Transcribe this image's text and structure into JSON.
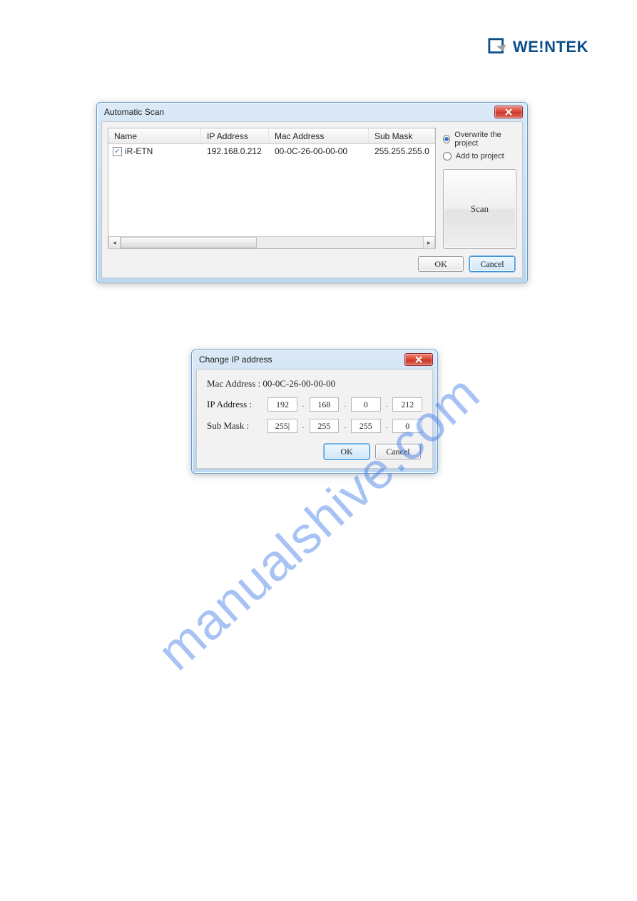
{
  "logo": {
    "brand": "WEINTEK"
  },
  "watermark": "manualshive.com",
  "dlg_scan": {
    "title": "Automatic Scan",
    "cols": {
      "name": "Name",
      "ip": "IP Address",
      "mac": "Mac Address",
      "mask": "Sub Mask"
    },
    "row": {
      "checked": "☑",
      "name": "iR-ETN",
      "ip": "192.168.0.212",
      "mac": "00-0C-26-00-00-00",
      "mask": "255.255.255.0"
    },
    "radio_overwrite": "Overwrite the project",
    "radio_add": "Add to project",
    "scan_btn": "Scan",
    "ok": "OK",
    "cancel": "Cancel"
  },
  "dlg_ip": {
    "title": "Change IP address",
    "mac_label": "Mac Address :",
    "mac_value": "00-0C-26-00-00-00",
    "ip_label": "IP Address :",
    "mask_label": "Sub Mask :",
    "ip": {
      "a": "192",
      "b": "168",
      "c": "0",
      "d": "212"
    },
    "mask": {
      "a": "255|",
      "b": "255",
      "c": "255",
      "d": "0"
    },
    "ok": "OK",
    "cancel": "Cancel"
  }
}
